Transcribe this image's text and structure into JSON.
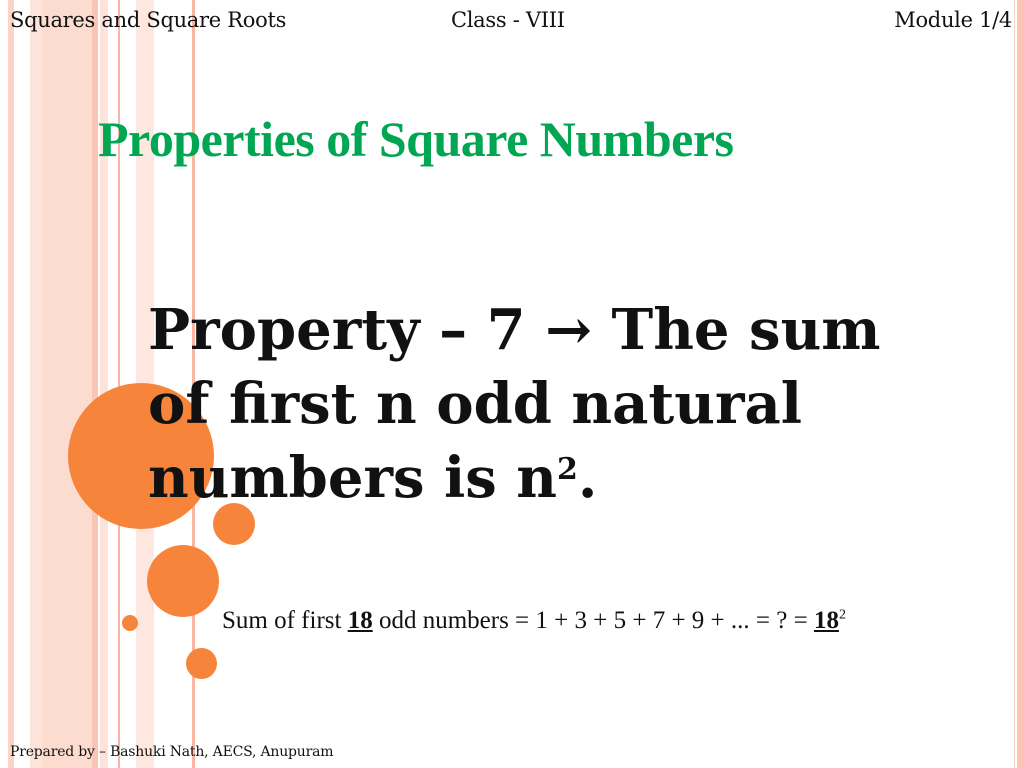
{
  "header": {
    "subject": "Squares and Square Roots",
    "class": "Class - VIII",
    "module": "Module 1/4"
  },
  "slide": {
    "title": "Properties of Square Numbers",
    "property_text": "Property – 7 → The sum of first n odd natural numbers is n",
    "property_exponent": "2",
    "property_end": ".",
    "example": {
      "prefix": "Sum of first ",
      "n": "18",
      "middle": " odd numbers = 1 + 3 + 5 + 7 + 9 + ... = ? = ",
      "base": "18",
      "exponent": "2"
    }
  },
  "footer": {
    "credit": "Prepared by – Bashuki Nath, AECS, Anupuram"
  },
  "colors": {
    "title": "#00a651",
    "accent_circle": "#f7843b",
    "stripe": "#fbc4b4"
  }
}
